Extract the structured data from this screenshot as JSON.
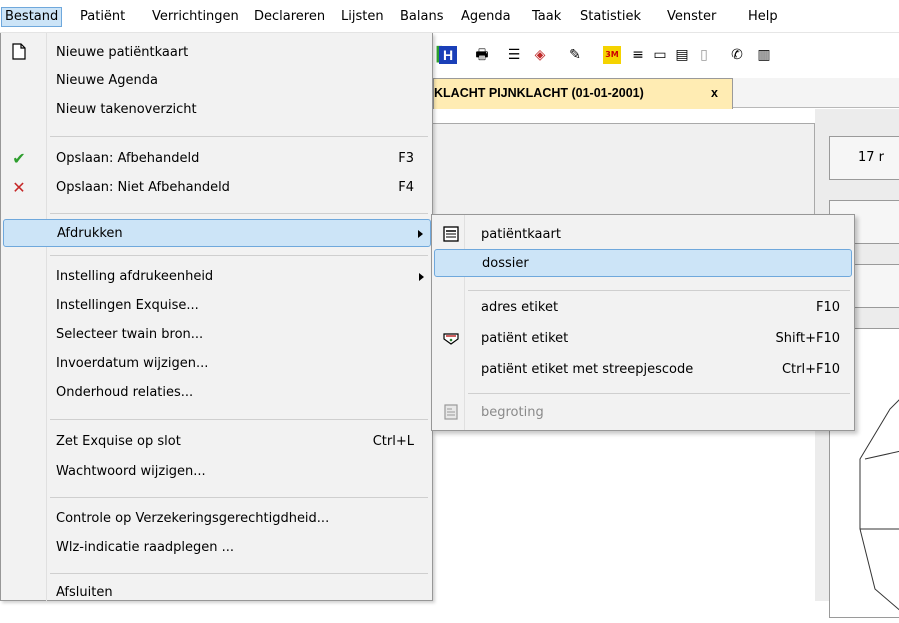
{
  "menubar": {
    "items": [
      "Bestand",
      "Patiënt",
      "Verrichtingen",
      "Declareren",
      "Lijsten",
      "Balans",
      "Agenda",
      "Taak",
      "Statistiek",
      "Venster",
      "Help"
    ]
  },
  "document_tab": {
    "label": "KLACHT PIJNKLACHT (01-01-2001)",
    "close": "x"
  },
  "right_panel": {
    "box1": "17 r"
  },
  "bestand_menu": {
    "items": [
      {
        "label": "Nieuwe patiëntkaart",
        "icon": "new-document-icon"
      },
      {
        "label": "Nieuwe Agenda"
      },
      {
        "label": "Nieuw takenoverzicht"
      },
      {
        "label": "Opslaan: Afbehandeld",
        "shortcut": "F3",
        "icon": "checkmark-icon"
      },
      {
        "label": "Opslaan: Niet Afbehandeld",
        "shortcut": "F4",
        "icon": "red-x-icon"
      },
      {
        "label": "Afdrukken",
        "submenu": true
      },
      {
        "label": "Instelling afdrukeenheid",
        "submenu": true
      },
      {
        "label": "Instellingen Exquise..."
      },
      {
        "label": "Selecteer twain bron..."
      },
      {
        "label": "Invoerdatum wijzigen..."
      },
      {
        "label": "Onderhoud relaties..."
      },
      {
        "label": "Zet Exquise op slot",
        "shortcut": "Ctrl+L"
      },
      {
        "label": "Wachtwoord wijzigen..."
      },
      {
        "label": "Controle op Verzekeringsgerechtigdheid..."
      },
      {
        "label": "Wlz-indicatie raadplegen ..."
      },
      {
        "label": "Afsluiten"
      }
    ]
  },
  "afdrukken_submenu": {
    "items": [
      {
        "label": "patiëntkaart",
        "icon": "card-list-icon"
      },
      {
        "label": "dossier"
      },
      {
        "label": "adres etiket",
        "shortcut": "F10"
      },
      {
        "label": "patiënt etiket",
        "shortcut": "Shift+F10",
        "icon": "label-print-icon"
      },
      {
        "label": "patiënt etiket met streepjescode",
        "shortcut": "Ctrl+F10"
      },
      {
        "label": "begroting",
        "icon": "document-disabled-icon",
        "disabled": true
      }
    ]
  },
  "colors": {
    "highlight": "#cce4f7",
    "highlight_border": "#6fa8dc",
    "tab_bg": "#ffecb3",
    "check": "#2e9e2e",
    "cross": "#c62828"
  }
}
